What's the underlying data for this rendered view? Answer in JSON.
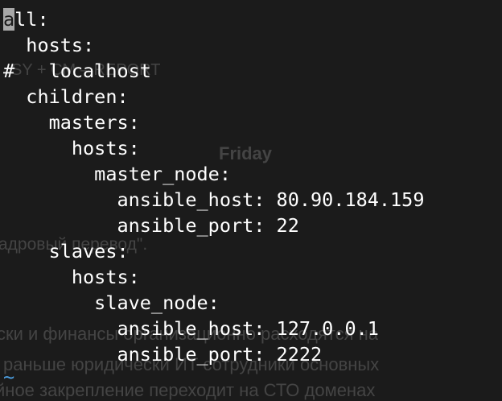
{
  "background_text": {
    "report": "SY + CM – REPORT",
    "friday": "Friday",
    "perevod": "адровый перевод\".",
    "line1": "ски и финансы организационно расходятся на",
    "line2": "раньше юридически ИТ сотрудники основных",
    "line3": "йное закрепление переходит на СТО доменах"
  },
  "editor": {
    "cursor_char": "a",
    "lines": [
      "ll:",
      "  hosts:",
      "#   localhost",
      "  children:",
      "    masters:",
      "      hosts:",
      "        master_node:",
      "          ansible_host: 80.90.184.159",
      "          ansible_port: 22",
      "    slaves:",
      "      hosts:",
      "        slave_node:",
      "          ansible_host: 127.0.0.1",
      "          ansible_port: 2222"
    ],
    "tilde": "~"
  },
  "colors": {
    "background": "#1b1b1b",
    "text": "#ffffff",
    "cursor": "#a8a8a8",
    "tilde": "#4ea2e6",
    "ghost": "#444444"
  }
}
